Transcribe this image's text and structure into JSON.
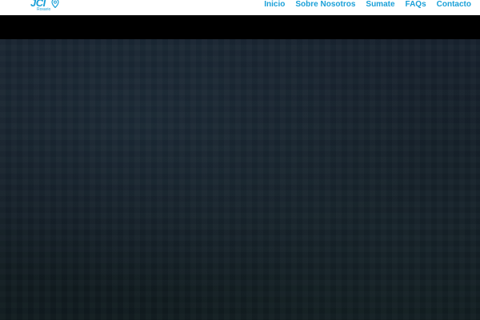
{
  "brand": {
    "name": "JCI",
    "subtitle": "Rosario",
    "color": "#1aa0d8",
    "pin_icon": "location-pin-icon"
  },
  "nav": {
    "color": "#1aa0d8",
    "items": [
      {
        "label": "Inicio"
      },
      {
        "label": "Sobre Nosotros"
      },
      {
        "label": "Sumate"
      },
      {
        "label": "FAQs"
      },
      {
        "label": "Contacto"
      }
    ]
  },
  "hero": {
    "background_color": "#15202a"
  },
  "band": {
    "background_color": "#000000"
  }
}
